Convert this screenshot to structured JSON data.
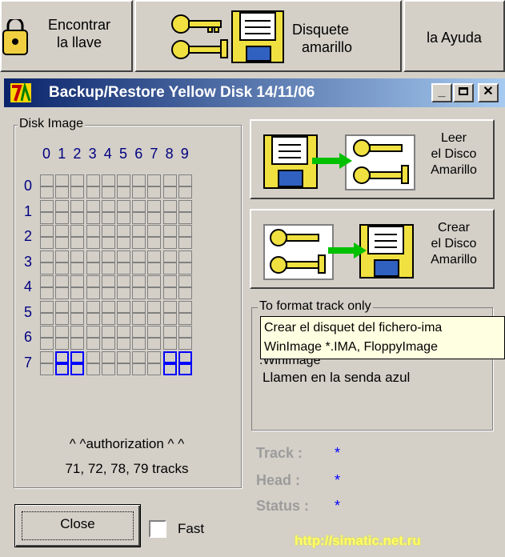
{
  "toolbar": {
    "find_key": [
      "Encontrar",
      "la llave"
    ],
    "yellow_disk": [
      "Disquete",
      "amarillo"
    ],
    "help": "la Ayuda"
  },
  "window": {
    "icon": "app-logo-icon",
    "title": "Backup/Restore Yellow Disk 14/11/06",
    "controls": [
      "minimize",
      "maximize",
      "close"
    ]
  },
  "disk_image": {
    "legend": "Disk Image",
    "col_labels": [
      "0",
      "1",
      "2",
      "3",
      "4",
      "5",
      "6",
      "7",
      "8",
      "9"
    ],
    "row_labels": [
      "0",
      "1",
      "2",
      "3",
      "4",
      "5",
      "6",
      "7"
    ],
    "selected_cells": [
      [
        7,
        1
      ],
      [
        7,
        2
      ],
      [
        7,
        8
      ],
      [
        7,
        9
      ]
    ],
    "auth_caption": "^ ^authorization ^ ^",
    "tracks_caption": "71, 72, 78, 79 tracks"
  },
  "buttons": {
    "read": [
      "Leer",
      "el Disco",
      "Amarillo"
    ],
    "create": [
      "Crear",
      "el Disco",
      "Amarillo"
    ],
    "close": "Close"
  },
  "options": {
    "fast_label": "Fast",
    "fast_checked": false
  },
  "info": {
    "legend_partial": "To format track only",
    "line_partial": ".WinImage",
    "line3": "Llamen en la senda azul"
  },
  "tooltip": {
    "line1": "Crear el disquet del fichero-ima",
    "line2": "WinImage *.IMA, FloppyImage"
  },
  "status": {
    "track_label": "Track :",
    "track_value": "*",
    "head_label": "Head :",
    "head_value": "*",
    "status_label": "Status :",
    "status_value": "*"
  },
  "footer": {
    "url": "http://simatic.net.ru"
  },
  "colors": {
    "title_start": "#0a246a",
    "grid_numbers": "#000080",
    "selected_cell": "#0000ff",
    "url": "#ffff66",
    "tooltip_bg": "#ffffe1"
  }
}
